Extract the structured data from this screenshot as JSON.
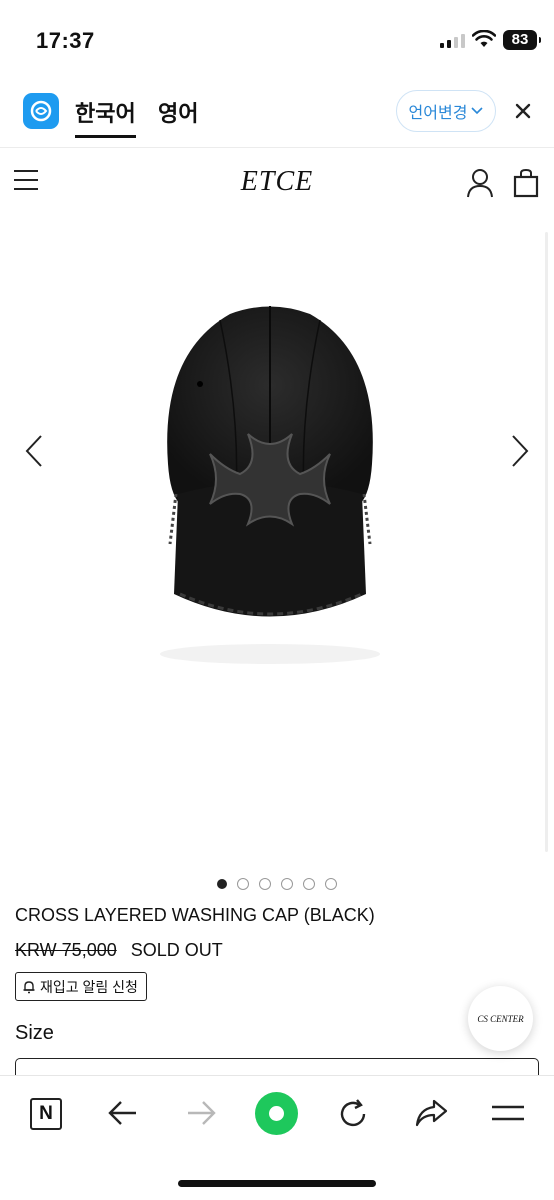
{
  "status_bar": {
    "time": "17:37",
    "battery": "83"
  },
  "translate_bar": {
    "source_lang": "한국어",
    "target_lang": "영어",
    "change_label": "언어변경"
  },
  "site": {
    "logo": "ETCE"
  },
  "product": {
    "name": "CROSS LAYERED WASHING CAP (BLACK)",
    "original_price": "KRW 75,000",
    "stock_status": "SOLD OUT",
    "restock_label": "재입고 알림 신청",
    "size_label": "Size",
    "image_count": 6,
    "active_image": 1
  },
  "cs_badge": "CS CENTER",
  "browser": {
    "naver_label": "N"
  }
}
